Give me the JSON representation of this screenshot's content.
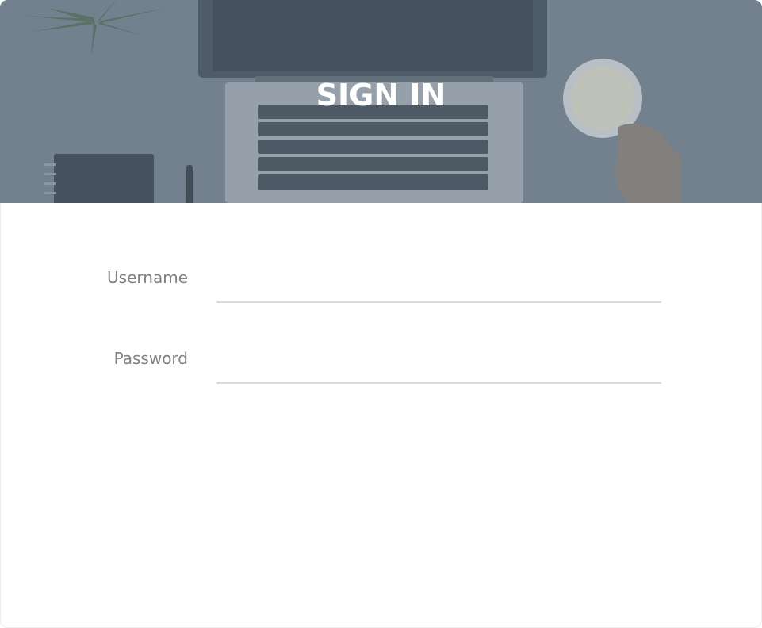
{
  "header": {
    "title": "SIGN IN"
  },
  "form": {
    "username": {
      "label": "Username",
      "value": "",
      "placeholder": ""
    },
    "password": {
      "label": "Password",
      "value": "",
      "placeholder": ""
    }
  },
  "colors": {
    "header_overlay": "#6f7e8c",
    "label_text": "#808080",
    "field_underline": "#dcdcdc",
    "background": "#ffffff"
  }
}
